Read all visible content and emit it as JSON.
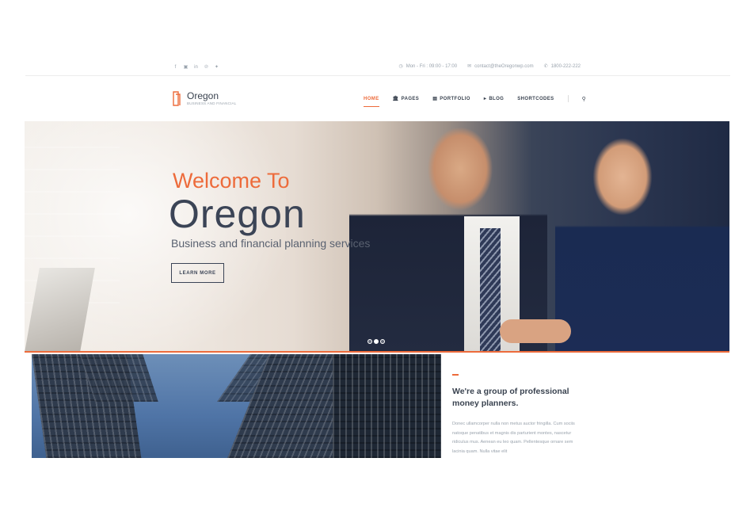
{
  "topbar": {
    "social": [
      "f",
      "in",
      "in",
      "p",
      "t"
    ],
    "social_icons": [
      "facebook-icon",
      "instagram-icon",
      "linkedin-icon",
      "pinterest-icon",
      "twitter-icon"
    ],
    "hours": "Mon - Fri : 09:00 - 17:00",
    "email": "contact@theOregonwp.com",
    "phone": "1800-222-222"
  },
  "logo": {
    "name": "Oregon",
    "tagline": "BUSINESS AND FINANCIAL"
  },
  "nav": {
    "items": [
      {
        "label": "HOME",
        "active": true
      },
      {
        "label": "PAGES",
        "icon": "bank-icon"
      },
      {
        "label": "PORTFOLIO",
        "icon": "briefcase-icon"
      },
      {
        "label": "BLOG",
        "icon": "megaphone-icon"
      },
      {
        "label": "SHORTCODES"
      }
    ],
    "search_icon": "search-icon"
  },
  "hero": {
    "welcome": "Welcome To",
    "title": "Oregon",
    "subtitle": "Business and financial planning services",
    "button": "LEARN MORE",
    "slides": 3,
    "active_slide": 2
  },
  "about": {
    "heading": "We're a group of professional money planners.",
    "text": "Donec ullamcorper nulla non metus auctor fringilla. Cum sociis natoque penatibus et magnis dis parturient montes, nascetur ridiculus mus. Aenean eu leo quam. Pellentesque ornare sem lacinia quam. Nulla vitae elit"
  },
  "colors": {
    "accent": "#ed6b3b",
    "text_dark": "#3a4350",
    "text_muted": "#9aa3ad"
  }
}
